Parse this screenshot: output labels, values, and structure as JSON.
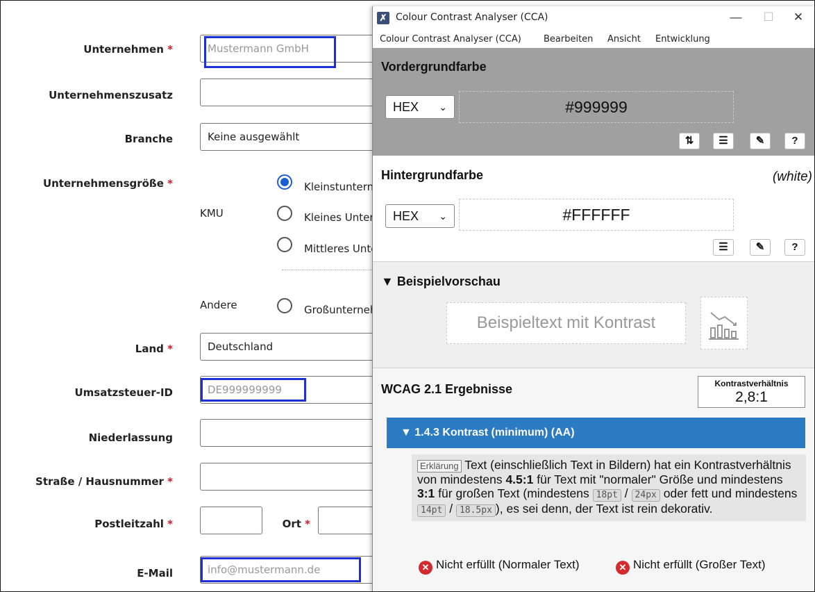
{
  "form": {
    "company": {
      "label": "Unternehmen",
      "required": "*",
      "placeholder": "Mustermann GmbH"
    },
    "company_suffix": {
      "label": "Unternehmenszusatz",
      "value": ""
    },
    "industry": {
      "label": "Branche",
      "value": "Keine ausgewählt"
    },
    "company_size": {
      "label": "Unternehmensgröße",
      "required": "*",
      "group_kmu": "KMU",
      "group_other": "Andere",
      "options": [
        {
          "label": "Kleinstunternehmen",
          "selected": true
        },
        {
          "label": "Kleines Unternehmen",
          "selected": false
        },
        {
          "label": "Mittleres Unternehmen",
          "selected": false
        },
        {
          "label": "Großunternehmen",
          "selected": false
        }
      ]
    },
    "country": {
      "label": "Land",
      "required": "*",
      "value": "Deutschland"
    },
    "vat": {
      "label": "Umsatzsteuer-ID",
      "placeholder": "DE999999999"
    },
    "branch": {
      "label": "Niederlassung",
      "value": ""
    },
    "street": {
      "label": "Straße / Hausnummer",
      "required": "*",
      "value": ""
    },
    "zip": {
      "label": "Postleitzahl",
      "required": "*",
      "value": ""
    },
    "city": {
      "label": "Ort",
      "required": "*",
      "value": ""
    },
    "email": {
      "label": "E-Mail",
      "placeholder": "info@mustermann.de"
    }
  },
  "cca": {
    "window_title": "Colour Contrast Analyser (CCA)",
    "window_controls": {
      "minimize": "—",
      "maximize": "☐",
      "close": "✕"
    },
    "menu": [
      "Colour Contrast Analyser (CCA)",
      "Bearbeiten",
      "Ansicht",
      "Entwicklung"
    ],
    "foreground": {
      "title": "Vordergrundfarbe",
      "format": "HEX",
      "value": "#999999"
    },
    "background": {
      "title": "Hintergrundfarbe",
      "format": "HEX",
      "value": "#FFFFFF",
      "name": "(white)"
    },
    "preview": {
      "title": "▼ Beispielvorschau",
      "sample_text": "Beispieltext mit Kontrast"
    },
    "results": {
      "title": "WCAG 2.1 Ergebnisse",
      "ratio_label": "Kontrastverhältnis",
      "ratio_value": "2,8:1",
      "criterion": "▼ 1.4.3 Kontrast (minimum) (AA)",
      "explain_tag": "Erklärung",
      "explain_1": "Text (einschließlich Text in Bildern) hat ein Kontrastverhältnis von mindestens",
      "ratio_normal": "4.5:1",
      "explain_2": "für Text mit \"normaler\" Größe und mindestens",
      "ratio_large": "3:1",
      "explain_3": "für großen Text (mindestens",
      "size_1": "18pt",
      "sep": "/",
      "size_2": "24px",
      "explain_4": "oder fett und mindestens",
      "size_3": "14pt",
      "size_4": "18.5px",
      "explain_5": "), es sei denn, der Text ist rein dekorativ.",
      "fail_normal": "Nicht erfüllt (Normaler Text)",
      "fail_large": "Nicht erfüllt (Großer Text)"
    }
  },
  "colors": {
    "highlight": "#1c2fd8",
    "required": "#d5182d",
    "radio_selected": "#1a5fd0",
    "fg_panel": "#a0a0a0",
    "accordion": "#2b7bc3",
    "fail": "#d32a2f"
  }
}
